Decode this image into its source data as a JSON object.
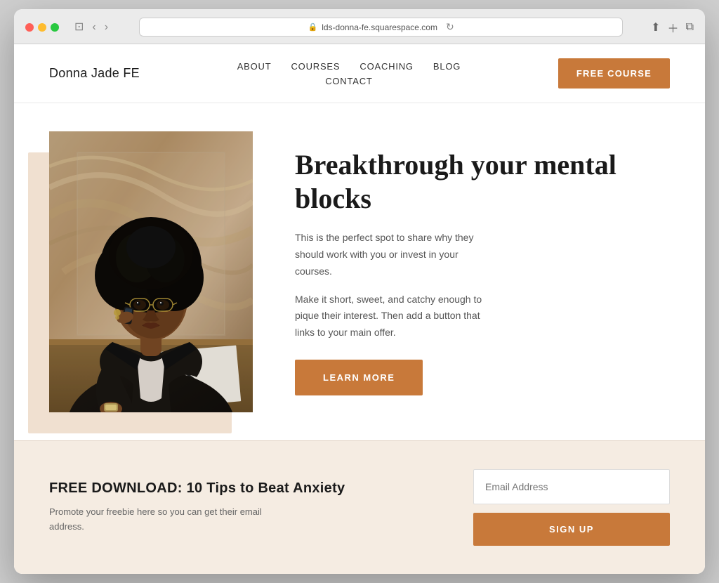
{
  "browser": {
    "url": "lds-donna-fe.squarespace.com",
    "reload_label": "↻"
  },
  "header": {
    "logo": "Donna Jade FE",
    "nav": {
      "about": "ABOUT",
      "courses": "COURSES",
      "coaching": "COACHING",
      "blog": "BLOG",
      "contact": "CONTACT"
    },
    "cta_button": "FREE COURSE"
  },
  "hero": {
    "title": "Breakthrough your mental blocks",
    "description1": "This is the perfect spot to share why they should work with you or invest in your courses.",
    "description2": "Make it short, sweet, and catchy enough to pique their interest. Then add a button that links to your main offer.",
    "cta_button": "LEARN MORE"
  },
  "download": {
    "title": "FREE DOWNLOAD: 10 Tips to Beat Anxiety",
    "description": "Promote your freebie here so you can get their email address.",
    "email_placeholder": "Email Address",
    "signup_button": "SIGN UP"
  },
  "colors": {
    "accent": "#c8793a",
    "bg_light": "#f5ece2",
    "hero_bg": "#f0e0d0"
  }
}
